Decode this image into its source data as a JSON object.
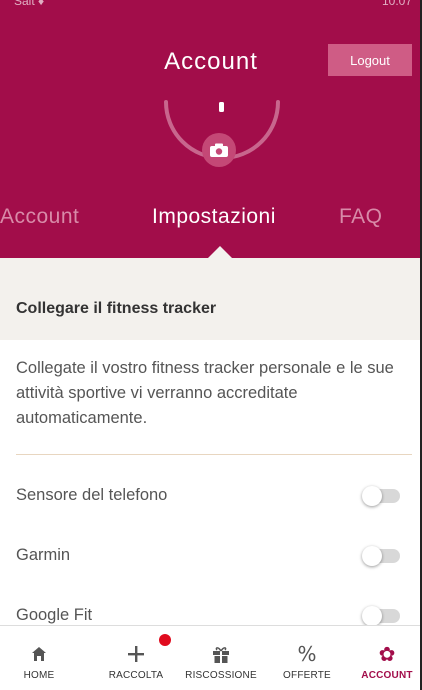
{
  "statusbar": {
    "carrier": "Salt ♦",
    "time": "10:07"
  },
  "header": {
    "title": "Account",
    "logout_label": "Logout"
  },
  "tabs": [
    {
      "label": "Account",
      "active": false
    },
    {
      "label": "Impostazioni",
      "active": true
    },
    {
      "label": "FAQ",
      "active": false
    }
  ],
  "section": {
    "title": "Collegare il fitness tracker",
    "description": "Collegate il vostro fitness tracker personale e le sue attività sportive vi verranno accreditate automaticamente."
  },
  "trackers": [
    {
      "label": "Sensore del telefono",
      "enabled": false
    },
    {
      "label": "Garmin",
      "enabled": false
    },
    {
      "label": "Google Fit",
      "enabled": false
    }
  ],
  "bottom_nav": [
    {
      "label": "HOME",
      "icon": "home-icon"
    },
    {
      "label": "RACCOLTA",
      "icon": "plus-icon"
    },
    {
      "label": "RISCOSSIONE",
      "icon": "gift-icon"
    },
    {
      "label": "OFFERTE",
      "icon": "percent-icon"
    },
    {
      "label": "ACCOUNT",
      "icon": "gear-icon",
      "active": true
    }
  ],
  "colors": {
    "brand": "#a20d4a",
    "badge": "#e00b1e",
    "section_bg": "#f3f1ed"
  }
}
